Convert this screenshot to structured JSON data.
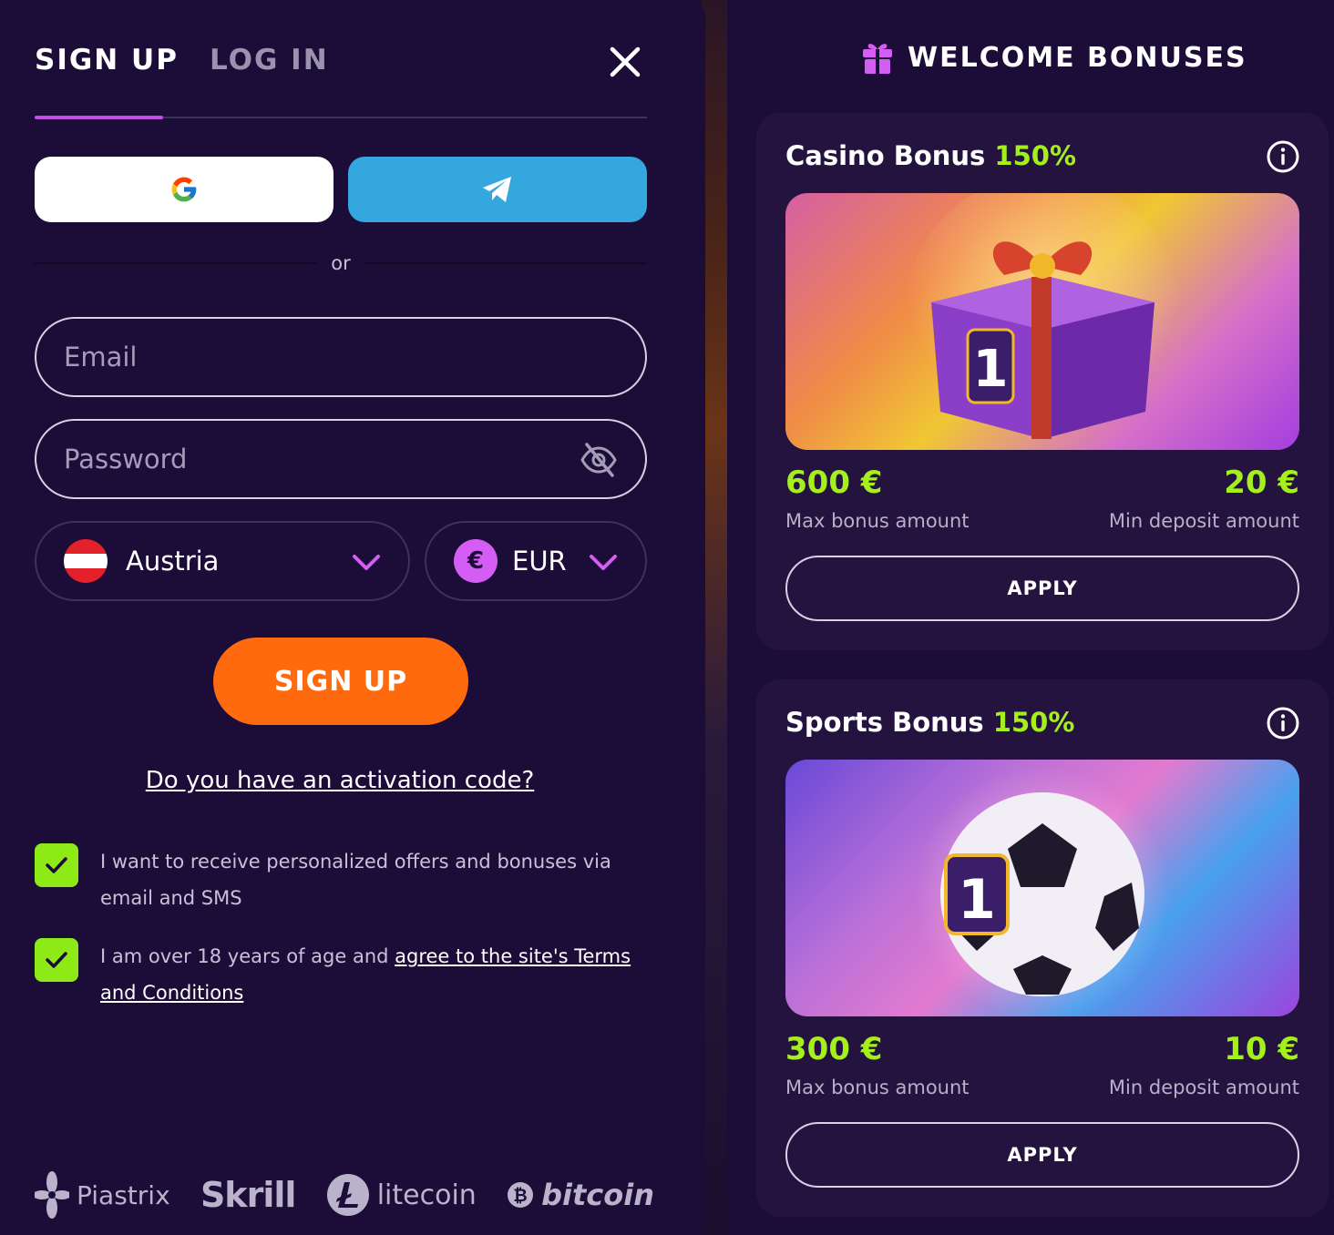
{
  "signup_form": {
    "tabs": [
      {
        "label": "SIGN UP",
        "active": true
      },
      {
        "label": "LOG IN",
        "active": false
      }
    ],
    "divider_text": "or",
    "email": {
      "placeholder": "Email",
      "value": ""
    },
    "password": {
      "placeholder": "Password",
      "value": ""
    },
    "country": {
      "value": "Austria"
    },
    "currency": {
      "value": "EUR",
      "symbol": "€"
    },
    "submit_label": "SIGN UP",
    "activation_link": "Do you have an activation code?",
    "checkboxes": [
      {
        "text": "I want to receive personalized offers and bonuses via email and SMS",
        "checked": true
      },
      {
        "text_prefix": "I am over 18 years of age and ",
        "link_text": "agree to the site's Terms and Conditions",
        "checked": true
      }
    ],
    "payment_methods": [
      "Piastrix",
      "Skrill",
      "litecoin",
      "bitcoin"
    ]
  },
  "bonuses": {
    "title": "WELCOME BONUSES",
    "cards": [
      {
        "name": "Casino Bonus",
        "percent": "150%",
        "max_bonus": "600 €",
        "max_bonus_label": "Max bonus amount",
        "min_deposit": "20 €",
        "min_deposit_label": "Min deposit amount",
        "apply_label": "APPLY"
      },
      {
        "name": "Sports Bonus",
        "percent": "150%",
        "max_bonus": "300 €",
        "max_bonus_label": "Max bonus amount",
        "min_deposit": "10 €",
        "min_deposit_label": "Min deposit amount",
        "apply_label": "APPLY"
      }
    ]
  },
  "colors": {
    "background": "#1b0c38",
    "accent_orange": "#ff6a0f",
    "accent_green": "#a4ef1c",
    "accent_purple": "#c24ee8",
    "telegram_blue": "#35a7df",
    "checkbox_green": "#8eea17"
  }
}
